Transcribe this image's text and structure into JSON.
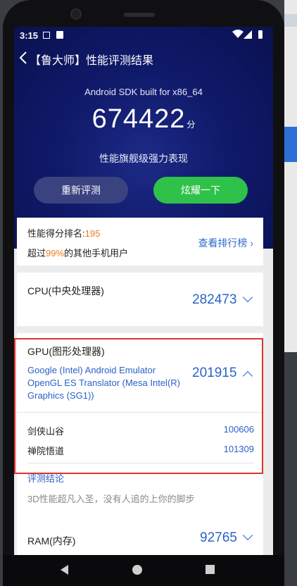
{
  "status_bar": {
    "time": "3:15"
  },
  "header": {
    "title": "【鲁大师】性能评测结果"
  },
  "hero": {
    "device": "Android SDK built for x86_64",
    "score": "674422",
    "score_unit": "分",
    "tagline": "性能旗舰级强力表现",
    "retest_label": "重新评测",
    "share_label": "炫耀一下"
  },
  "rank": {
    "prefix": "性能得分排名:",
    "rank_value": "195",
    "beat_prefix": "超过",
    "beat_percent": "99%",
    "beat_suffix": "的其他手机用户",
    "view_label": "查看排行榜"
  },
  "cpu": {
    "label": "CPU(中央处理器)",
    "score": "282473"
  },
  "gpu": {
    "label": "GPU(图形处理器)",
    "score": "201915",
    "description": "Google (Intel) Android Emulator OpenGL ES Translator (Mesa Intel(R) Graphics (SG1))",
    "sub_items": [
      {
        "name": "剑侠山谷",
        "value": "100606"
      },
      {
        "name": "禅院悟道",
        "value": "101309"
      }
    ],
    "eval_title": "评测结论",
    "eval_text": "3D性能超凡入圣，没有人追的上你的脚步"
  },
  "ram": {
    "label": "RAM(内存)",
    "score": "92765"
  },
  "colors": {
    "hero_bg": "#0f1968",
    "accent_blue": "#2a62c9",
    "share_green": "#2fc24a",
    "highlight_red": "#e03131",
    "rank_orange": "#f07a1e"
  }
}
